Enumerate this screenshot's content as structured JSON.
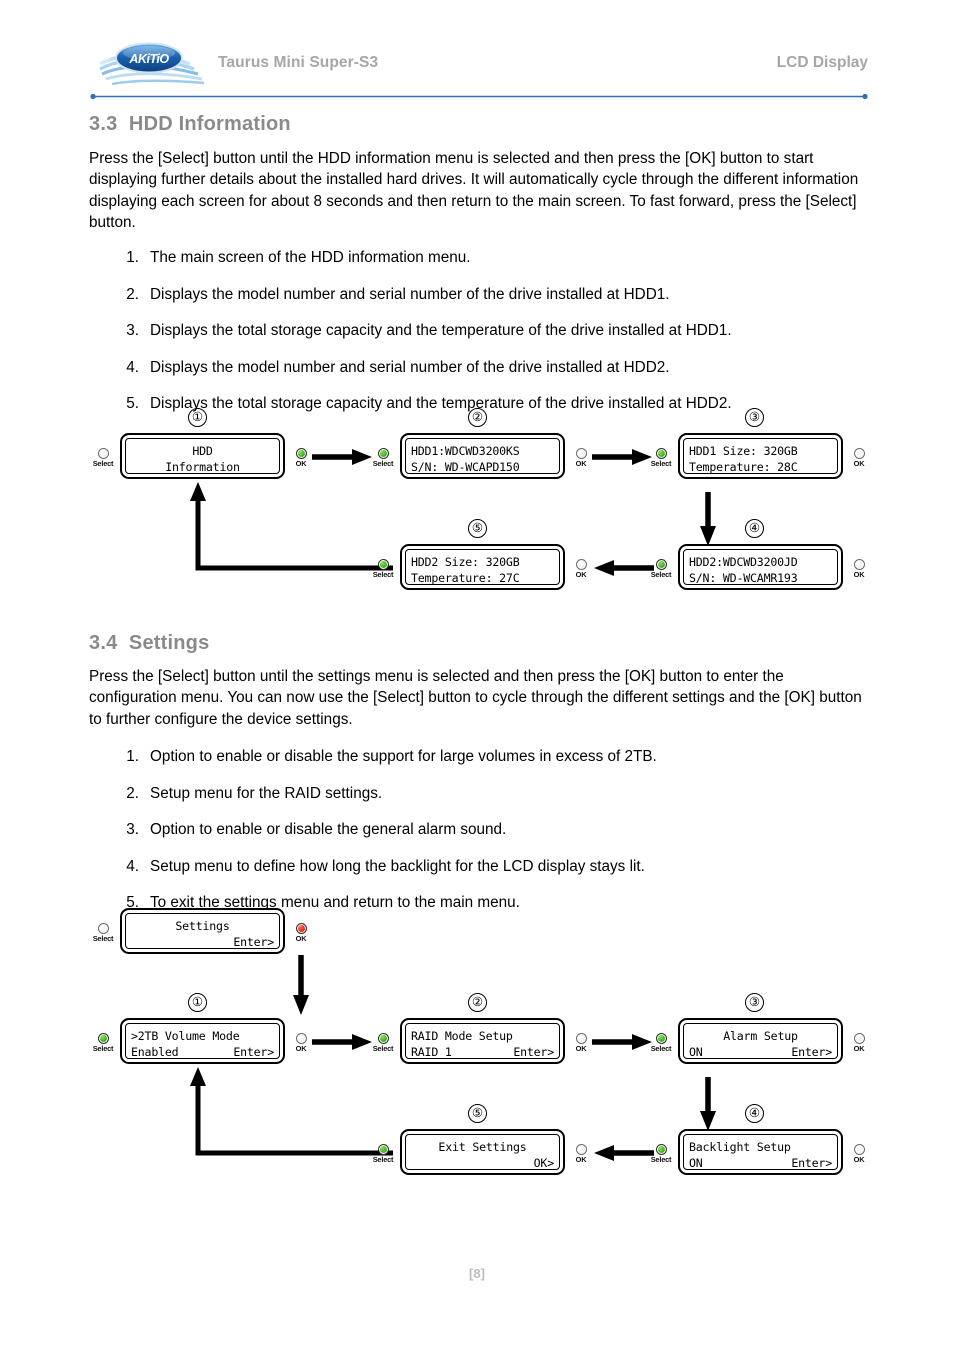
{
  "header": {
    "logo_alt": "AKiTiO",
    "product": "Taurus Mini Super-S3",
    "section": "LCD Display"
  },
  "footer": {
    "page": "[8]"
  },
  "sections": [
    {
      "number": "3.3",
      "title": "HDD Information",
      "paragraph": "Press the [Select] button until the HDD information menu is selected and then press the [OK] button to start displaying further details about the installed hard drives. It will automatically cycle through the different information displaying each screen for about 8 seconds and then return to the main screen. To fast forward, press the [Select] button.",
      "items": [
        {
          "num": "1.",
          "text": "The main screen of the HDD information menu."
        },
        {
          "num": "2.",
          "text": "Displays the model number and serial number of the drive installed at HDD1."
        },
        {
          "num": "3.",
          "text": "Displays the total storage capacity and the temperature of the drive installed at HDD1."
        },
        {
          "num": "4.",
          "text": "Displays the model number and serial number of the drive installed at HDD2."
        },
        {
          "num": "5.",
          "text": "Displays the total storage capacity and the temperature of the drive installed at HDD2."
        }
      ]
    },
    {
      "number": "3.4",
      "title": "Settings",
      "paragraph": "Press the [Select] button until the settings menu is selected and then press the [OK] button to enter the configuration menu. You can now use the [Select] button to cycle through the different settings and the [OK] button to further configure the device settings.",
      "items": [
        {
          "num": "1.",
          "text": "Option to enable or disable the support for large volumes in excess of 2TB."
        },
        {
          "num": "2.",
          "text": "Setup menu for the RAID settings."
        },
        {
          "num": "3.",
          "text": "Option to enable or disable the general alarm sound."
        },
        {
          "num": "4.",
          "text": "Setup menu to define how long the backlight for the LCD display stays lit."
        },
        {
          "num": "5.",
          "text": "To exit the settings menu and return to the main menu."
        }
      ]
    }
  ],
  "button_labels": {
    "select": "Select",
    "ok": "OK"
  },
  "hdd_diagram": {
    "steps": [
      "①",
      "②",
      "③",
      "④",
      "⑤"
    ],
    "screens": [
      {
        "step": "①",
        "line1": "HDD",
        "line2": "Information",
        "align1": "center",
        "align2": "center",
        "left_button": {
          "label": "Select",
          "state": "grey"
        },
        "right_button": {
          "label": "OK",
          "state": "green"
        }
      },
      {
        "step": "②",
        "line1": "HDD1:WDCWD3200KS",
        "line2": "S/N: WD-WCAPD150",
        "align1": "left",
        "align2": "left",
        "left_button": {
          "label": "Select",
          "state": "green"
        },
        "right_button": {
          "label": "OK",
          "state": "grey"
        }
      },
      {
        "step": "③",
        "line1": "HDD1 Size: 320GB",
        "line2": "Temperature: 28C",
        "align1": "left",
        "align2": "left",
        "left_button": {
          "label": "Select",
          "state": "green"
        },
        "right_button": {
          "label": "OK",
          "state": "grey"
        }
      },
      {
        "step": "④",
        "line1": "HDD2:WDCWD3200JD",
        "line2": "S/N: WD-WCAMR193",
        "align1": "left",
        "align2": "left",
        "left_button": {
          "label": "Select",
          "state": "green"
        },
        "right_button": {
          "label": "OK",
          "state": "grey"
        }
      },
      {
        "step": "⑤",
        "line1": "HDD2 Size: 320GB",
        "line2": "Temperature: 27C",
        "align1": "left",
        "align2": "left",
        "left_button": {
          "label": "Select",
          "state": "green"
        },
        "right_button": {
          "label": "OK",
          "state": "grey"
        }
      }
    ]
  },
  "settings_diagram": {
    "entry_screen": {
      "line1": "Settings",
      "line2_left": "",
      "line2_right": "Enter>",
      "left_button": {
        "label": "Select",
        "state": "grey"
      },
      "right_button": {
        "label": "OK",
        "state": "red"
      }
    },
    "screens": [
      {
        "step": "①",
        "line1": ">2TB Volume Mode",
        "line2_left": "Enabled",
        "line2_right": "Enter>",
        "align1": "left",
        "left_button": {
          "label": "Select",
          "state": "green"
        },
        "right_button": {
          "label": "OK",
          "state": "grey"
        }
      },
      {
        "step": "②",
        "line1": "RAID Mode Setup",
        "line2_left": "RAID 1",
        "line2_right": "Enter>",
        "align1": "left",
        "left_button": {
          "label": "Select",
          "state": "green"
        },
        "right_button": {
          "label": "OK",
          "state": "grey"
        }
      },
      {
        "step": "③",
        "line1": "Alarm Setup",
        "line2_left": "ON",
        "line2_right": "Enter>",
        "align1": "center",
        "left_button": {
          "label": "Select",
          "state": "green"
        },
        "right_button": {
          "label": "OK",
          "state": "grey"
        }
      },
      {
        "step": "④",
        "line1": "Backlight Setup",
        "line2_left": "ON",
        "line2_right": "Enter>",
        "align1": "left",
        "left_button": {
          "label": "Select",
          "state": "green"
        },
        "right_button": {
          "label": "OK",
          "state": "grey"
        }
      },
      {
        "step": "⑤",
        "line1": "Exit Settings",
        "line2_left": "",
        "line2_right": "OK>",
        "align1": "center",
        "left_button": {
          "label": "Select",
          "state": "green"
        },
        "right_button": {
          "label": "OK",
          "state": "grey"
        }
      }
    ]
  },
  "colors": {
    "heading_grey": "#8a8a8a",
    "header_grey": "#a6a6a6",
    "led_green": "#3fb024",
    "led_red": "#e52314",
    "logo_blue": "#1b63b0",
    "footer_grey": "#bdbdbd"
  }
}
